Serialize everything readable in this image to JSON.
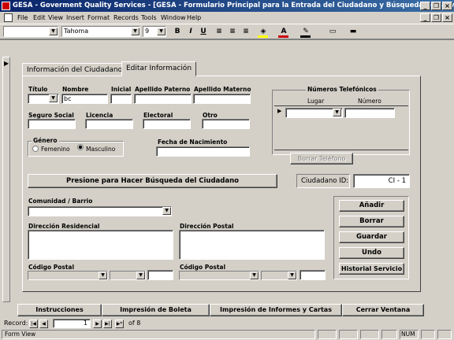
{
  "window": {
    "title": "GESA - Goverment Quality Services - [GESA - Formulario Principal para la Entrada del Ciudadano y Búsqueda de Servicios Solicit..."
  },
  "menu": [
    "File",
    "Edit",
    "View",
    "Insert",
    "Format",
    "Records",
    "Tools",
    "Window",
    "Help"
  ],
  "toolbar": {
    "object_value": "",
    "font": "Tahoma",
    "size": "9",
    "bold": "B",
    "italic": "I",
    "underline": "U"
  },
  "tabs": {
    "info": "Información del Ciudadano",
    "edit": "Editar Información"
  },
  "form": {
    "titulo": "Título",
    "nombre": "Nombre",
    "nombre_value": "bc",
    "inicial": "Inicial",
    "apellido_paterno": "Apellido Paterno",
    "apellido_materno": "Apellido Materno",
    "seguro_social": "Seguro Social",
    "licencia": "Licencia",
    "electoral": "Electoral",
    "otro": "Otro",
    "genero": "Género",
    "femenino": "Femenino",
    "masculino": "Masculino",
    "fecha_nacimiento": "Fecha de Nacimiento",
    "telefonos_title": "Números Telefónicos",
    "lugar": "Lugar",
    "numero": "Número",
    "borrar_telefono": "Borrar Teléfono",
    "buscar": "Presione para Hacer Búsqueda del Ciudadano",
    "ciudadano_id_label": "Ciudadano ID:",
    "ciudadano_id_value": "CI - 1",
    "comunidad": "Comunidad / Barrio",
    "dir_residencial": "Dirección Residencial",
    "dir_postal": "Dirección Postal",
    "codigo_postal_1": "Código Postal",
    "codigo_postal_2": "Código Postal"
  },
  "actions": {
    "anadir": "Añadir",
    "borrar": "Borrar",
    "guardar": "Guardar",
    "undo": "Undo",
    "historial": "Historial Servicio"
  },
  "bottom_buttons": {
    "instrucciones": "Instrucciones",
    "boleta": "Impresión de Boleta",
    "informes": "Impresión de Informes y Cartas",
    "cerrar": "Cerrar Ventana"
  },
  "record_nav": {
    "label": "Record:",
    "current": "1",
    "of": "of 8"
  },
  "status": {
    "text": "Form View",
    "num": "NUM"
  }
}
